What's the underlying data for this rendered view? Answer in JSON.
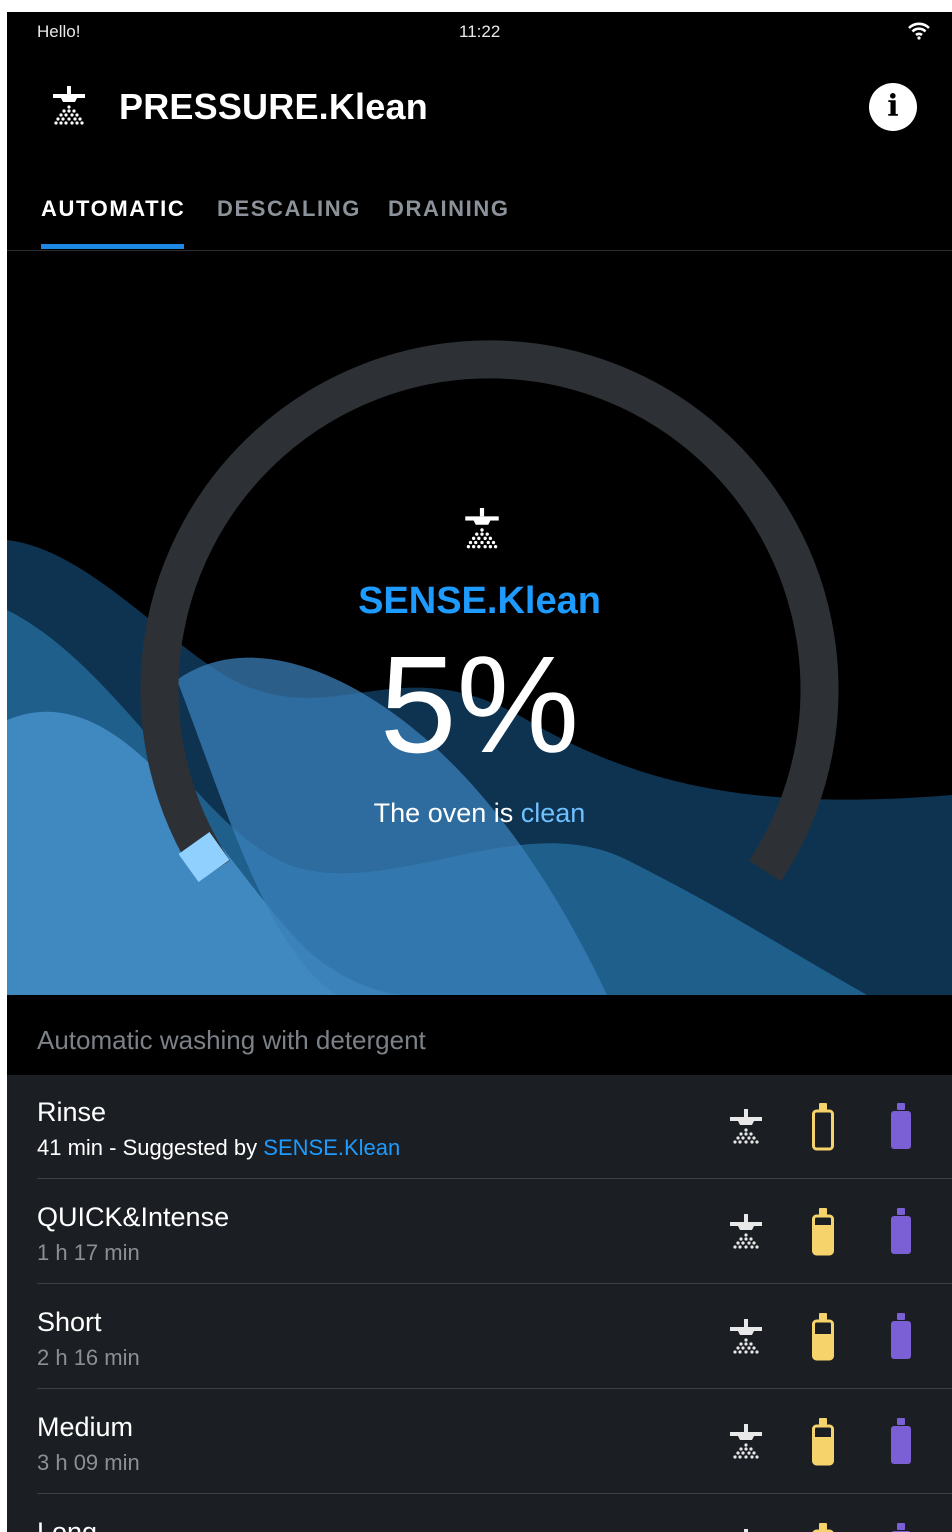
{
  "status_bar": {
    "greeting": "Hello!",
    "time": "11:22",
    "wifi_icon": "wifi-icon"
  },
  "app_bar": {
    "title": "PRESSURE.Klean",
    "logo_icon": "shower-icon",
    "info_icon": "info-icon",
    "info_label": "i"
  },
  "tabs": [
    {
      "label": "AUTOMATIC",
      "active": true
    },
    {
      "label": "DESCALING",
      "active": false
    },
    {
      "label": "DRAINING",
      "active": false
    }
  ],
  "hero": {
    "icon": "shower-icon",
    "brand": "SENSE.Klean",
    "percent": "5%",
    "progress": 0.05,
    "status_prefix": "The oven is",
    "status_word": "clean",
    "colors": {
      "accent": "#1e9bff",
      "ring_track": "#2d3136",
      "ring_fill": "#8fd0ff"
    }
  },
  "section": {
    "title": "Automatic washing with detergent"
  },
  "programs": [
    {
      "name": "Rinse",
      "duration": "41 min",
      "suggest_prefix": " - Suggested by ",
      "suggest_brand": "SENSE.Klean",
      "yellow_fill": 0.0
    },
    {
      "name": "QUICK&Intense",
      "duration": "1 h 17 min",
      "yellow_fill": 0.75
    },
    {
      "name": "Short",
      "duration": "2 h 16 min",
      "yellow_fill": 0.65
    },
    {
      "name": "Medium",
      "duration": "3 h 09 min",
      "yellow_fill": 0.7
    },
    {
      "name": "Long",
      "duration": "",
      "yellow_fill": 0.7
    }
  ],
  "program_icons": {
    "shower": "shower-icon",
    "detergent": "detergent-bottle-icon",
    "rinse_aid": "rinse-aid-bottle-icon"
  },
  "icon_colors": {
    "shower": "#e8e8e8",
    "detergent": "#f6d46b",
    "rinse_aid": "#7b5fd4"
  }
}
